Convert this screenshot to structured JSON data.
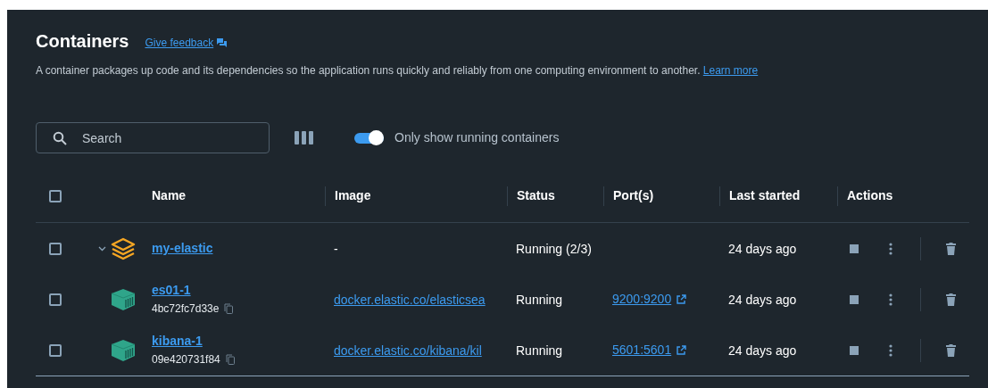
{
  "header": {
    "title": "Containers",
    "feedback_link": "Give feedback",
    "description": "A container packages up code and its dependencies so the application runs quickly and reliably from one computing environment to another.",
    "learn_more": "Learn more"
  },
  "toolbar": {
    "search": {
      "placeholder": "Search"
    },
    "running_toggle": {
      "label": "Only show running containers",
      "on": true
    }
  },
  "table": {
    "select_all": {
      "checked": false
    },
    "columns": [
      "Name",
      "Image",
      "Status",
      "Port(s)",
      "Last started",
      "Actions"
    ],
    "rows": [
      {
        "kind": "group",
        "checked": false,
        "expanded": true,
        "name": "my-elastic",
        "image": "-",
        "status": "Running (2/3)",
        "last_started": "24 days ago"
      },
      {
        "kind": "container",
        "checked": false,
        "name": "es01-1",
        "id": "4bc72fc7d33e",
        "image": "docker.elastic.co/elasticsea",
        "status": "Running",
        "port": "9200:9200",
        "last_started": "24 days ago"
      },
      {
        "kind": "container",
        "checked": false,
        "name": "kibana-1",
        "id": "09e420731f84",
        "image": "docker.elastic.co/kibana/kil",
        "status": "Running",
        "port": "5601:5601",
        "last_started": "24 days ago"
      }
    ]
  }
}
